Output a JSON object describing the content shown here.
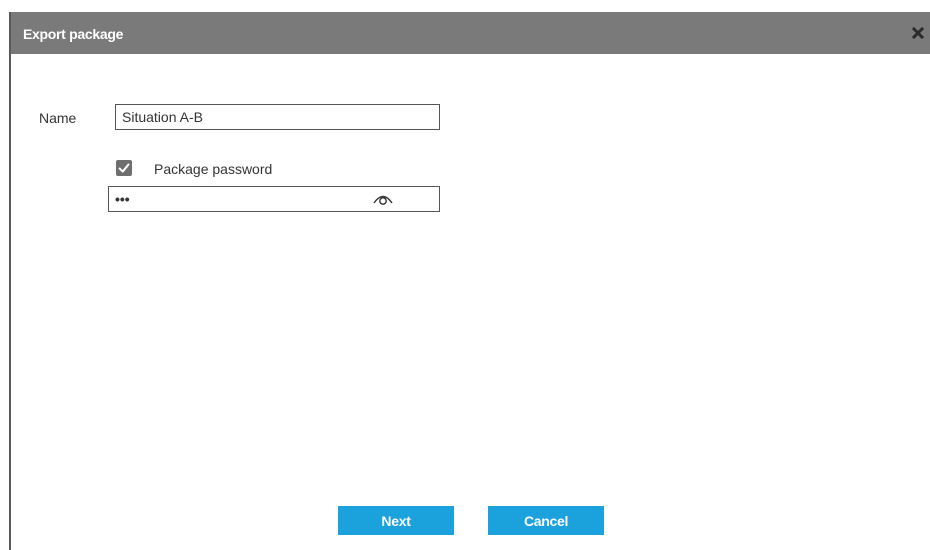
{
  "dialog": {
    "title": "Export package",
    "close_icon": "close-icon",
    "colors": {
      "titlebar": "#7a7a7a",
      "button": "#1ba1dc",
      "checkbox": "#6e6e6e"
    }
  },
  "form": {
    "name_label": "Name",
    "name_value": "Situation A-B",
    "package_password_checked": true,
    "package_password_label": "Package password",
    "password_value": "•••",
    "show_password_icon": "eye-icon"
  },
  "buttons": {
    "next_label": "Next",
    "cancel_label": "Cancel"
  }
}
